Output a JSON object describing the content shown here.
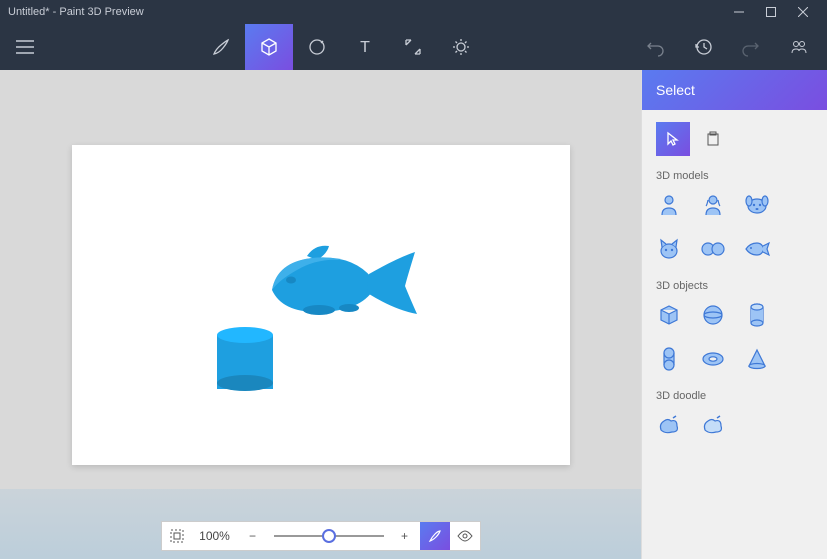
{
  "window": {
    "title": "Untitled* - Paint 3D Preview"
  },
  "toolbar": {
    "tools": [
      "brush",
      "3d",
      "shapes",
      "text",
      "transform",
      "effects"
    ],
    "active": "3d"
  },
  "sidebar": {
    "header": "Select",
    "sections": {
      "models_label": "3D models",
      "objects_label": "3D objects",
      "doodle_label": "3D doodle"
    },
    "models": [
      "man",
      "woman",
      "dog",
      "cat",
      "ears",
      "fish"
    ],
    "objects": [
      "cube",
      "sphere",
      "cylinder",
      "capsule",
      "torus",
      "cone"
    ],
    "doodle": [
      "soft",
      "sharp"
    ]
  },
  "zoom": {
    "value": "100%",
    "slider": 50
  },
  "canvas": {
    "objects": [
      "fish-model",
      "cylinder-object"
    ]
  },
  "colors": {
    "accent_start": "#5a7bf0",
    "accent_end": "#7a4ee0",
    "shape_blue": "#1e9fe0",
    "icon_blue": "#3e78d6",
    "icon_fill": "#9dc4f5"
  }
}
